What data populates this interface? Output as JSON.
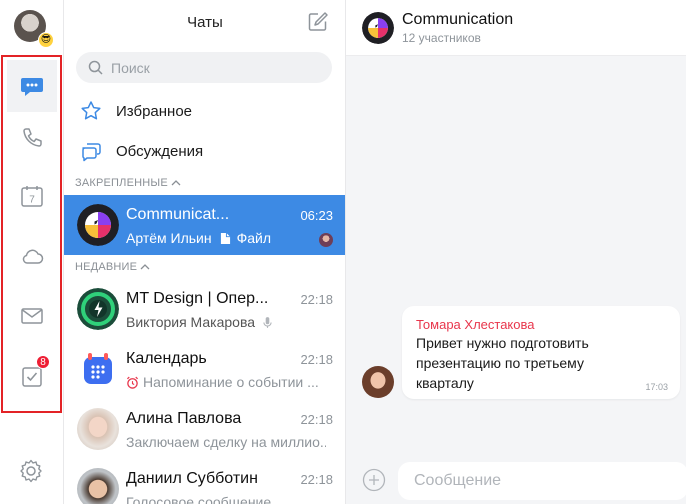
{
  "rail": {
    "profile_emoji": "😎",
    "tasks_badge": "8",
    "accent_color": "#3d8ae4",
    "highlight_color": "#e32326"
  },
  "list": {
    "title": "Чаты",
    "search_placeholder": "Поиск",
    "favorites_label": "Избранное",
    "discussions_label": "Обсуждения",
    "pinned_section": "ЗАКРЕПЛЕННЫЕ",
    "recent_section": "НЕДАВНИЕ",
    "pinned_chat": {
      "name": "Communicat...",
      "time": "06:23",
      "sender": "Артём Ильин",
      "attachment": "Файл"
    },
    "chats": [
      {
        "name": "MT Design | Опер...",
        "time": "22:18",
        "preview": "Виктория Макарова",
        "icon": "microphone-icon"
      },
      {
        "name": "Календарь",
        "time": "22:18",
        "preview": "Напоминание о событии ...",
        "icon": "alarm-clock-icon"
      },
      {
        "name": "Алина Павлова",
        "time": "22:18",
        "preview": "Заключаем сделку на миллио..."
      },
      {
        "name": "Даниил Субботин",
        "time": "22:18",
        "preview": "Голосовое сообщение"
      }
    ]
  },
  "conversation": {
    "title": "Communication",
    "subtitle": "12 участников",
    "message": {
      "author": "Томара Хлестакова",
      "text": "Привет нужно подготовить презентацию по третьему кварталу",
      "time": "17:03"
    },
    "composer_placeholder": "Сообщение"
  }
}
